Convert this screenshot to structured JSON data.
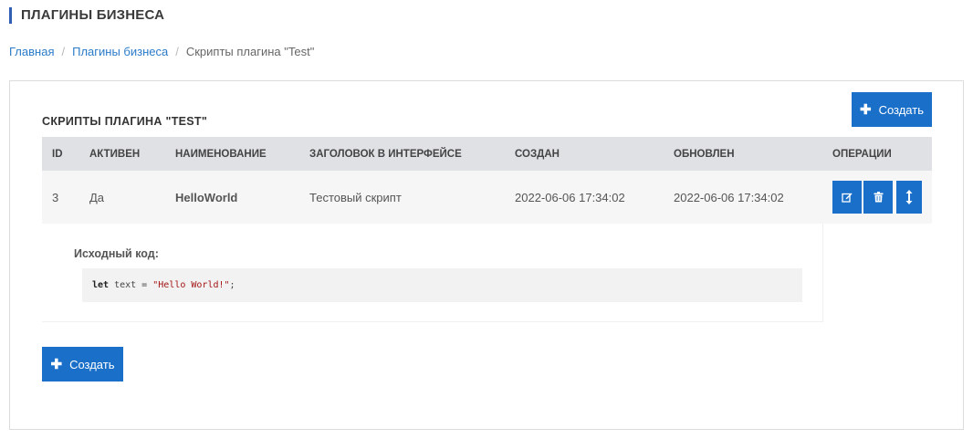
{
  "page": {
    "title": "ПЛАГИНЫ БИЗНЕСА"
  },
  "breadcrumb": {
    "items": [
      "Главная",
      "Плагины бизнеса"
    ],
    "separator": "/",
    "current": "Скрипты плагина \"Test\""
  },
  "panel": {
    "section_title": "СКРИПТЫ ПЛАГИНА \"TEST\"",
    "create_button": {
      "icon": "plus-icon",
      "label": "Создать"
    }
  },
  "table": {
    "columns": [
      "ID",
      "АКТИВЕН",
      "НАИМЕНОВАНИЕ",
      "ЗАГОЛОВОК В ИНТЕРФЕЙСЕ",
      "СОЗДАН",
      "ОБНОВЛЕН",
      "ОПЕРАЦИИ"
    ],
    "rows": [
      {
        "id": "3",
        "active": "Да",
        "name": "HelloWorld",
        "ui_title": "Тестовый скрипт",
        "created": "2022-06-06 17:34:02",
        "updated": "2022-06-06 17:34:02",
        "operations": [
          "edit-icon",
          "trash-icon",
          "expand-vertical-icon"
        ]
      }
    ],
    "detail": {
      "label": "Исходный код:",
      "code": {
        "keyword": "let",
        "identifier": " text = ",
        "string": "\"Hello World!\"",
        "tail": ";"
      }
    }
  },
  "colors": {
    "accent": "#1a6fc9",
    "title_bar": "#2f5fb3",
    "header_bg": "#dfe1e5",
    "row_bg": "#f6f6f6",
    "link": "#2b7bc9",
    "code_string": "#a31515"
  }
}
